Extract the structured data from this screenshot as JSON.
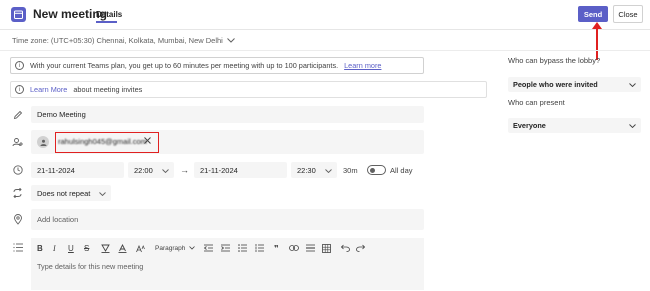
{
  "header": {
    "title": "New meeting",
    "tab_details": "Details",
    "send_label": "Send",
    "close_label": "Close"
  },
  "timezone": "Time zone: (UTC+05:30) Chennai, Kolkata, Mumbai, New Delhi",
  "info": {
    "plan_text": "With your current Teams plan, you get up to 60 minutes per meeting with up to 100 participants.",
    "plan_link": "Learn more",
    "invites_link": "Learn More",
    "invites_text": "about meeting invites"
  },
  "form": {
    "title_value": "Demo Meeting",
    "attendee_email": "rahulsingh045@gmail.com",
    "start_date": "21-11-2024",
    "start_time": "22:00",
    "end_date": "21-11-2024",
    "end_time": "22:30",
    "duration": "30m",
    "all_day_label": "All day",
    "repeat_value": "Does not repeat",
    "location_placeholder": "Add location",
    "details_placeholder": "Type details for this new meeting",
    "paragraph_label": "Paragraph"
  },
  "side": {
    "bypass_label": "Who can bypass the lobby?",
    "bypass_value": "People who were invited",
    "present_label": "Who can present",
    "present_value": "Everyone"
  },
  "colors": {
    "accent": "#5b5fc7",
    "annotation": "#e02020"
  }
}
